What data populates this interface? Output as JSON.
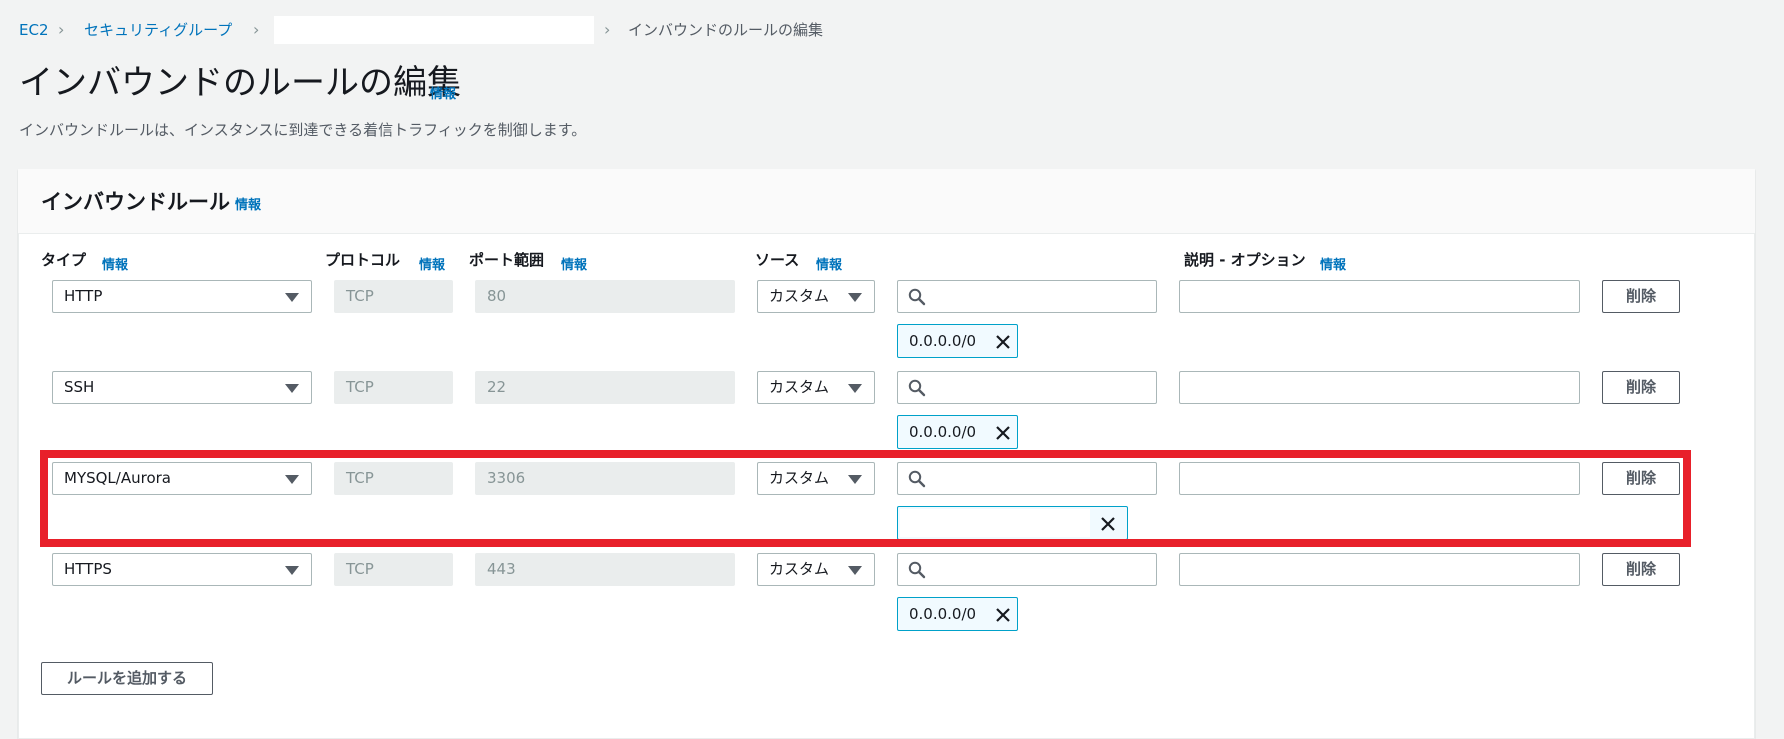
{
  "breadcrumb": {
    "root": "EC2",
    "group": "セキュリティグループ",
    "current": "インバウンドのルールの編集"
  },
  "page": {
    "title": "インバウンドのルールの編集",
    "info": "情報",
    "description": "インバウンドルールは、インスタンスに到達できる着信トラフィックを制御します。"
  },
  "panel": {
    "title": "インバウンドルール",
    "info": "情報",
    "columns": {
      "type": "タイプ",
      "protocol": "プロトコル",
      "port": "ポート範囲",
      "source": "ソース",
      "description": "説明 - オプション",
      "info": "情報"
    },
    "rows": [
      {
        "type": "HTTP",
        "protocol": "TCP",
        "port": "80",
        "source": "カスタム",
        "cidr": "0.0.0.0/0",
        "delete": "削除"
      },
      {
        "type": "SSH",
        "protocol": "TCP",
        "port": "22",
        "source": "カスタム",
        "cidr": "0.0.0.0/0",
        "delete": "削除"
      },
      {
        "type": "MYSQL/Aurora",
        "protocol": "TCP",
        "port": "3306",
        "source": "カスタム",
        "cidr": "",
        "delete": "削除"
      },
      {
        "type": "HTTPS",
        "protocol": "TCP",
        "port": "443",
        "source": "カスタム",
        "cidr": "0.0.0.0/0",
        "delete": "削除"
      }
    ],
    "add_rule": "ルールを追加する"
  },
  "colors": {
    "accent": "#0073bb",
    "token_border": "#00a1c9",
    "highlight": "#e8202a"
  }
}
